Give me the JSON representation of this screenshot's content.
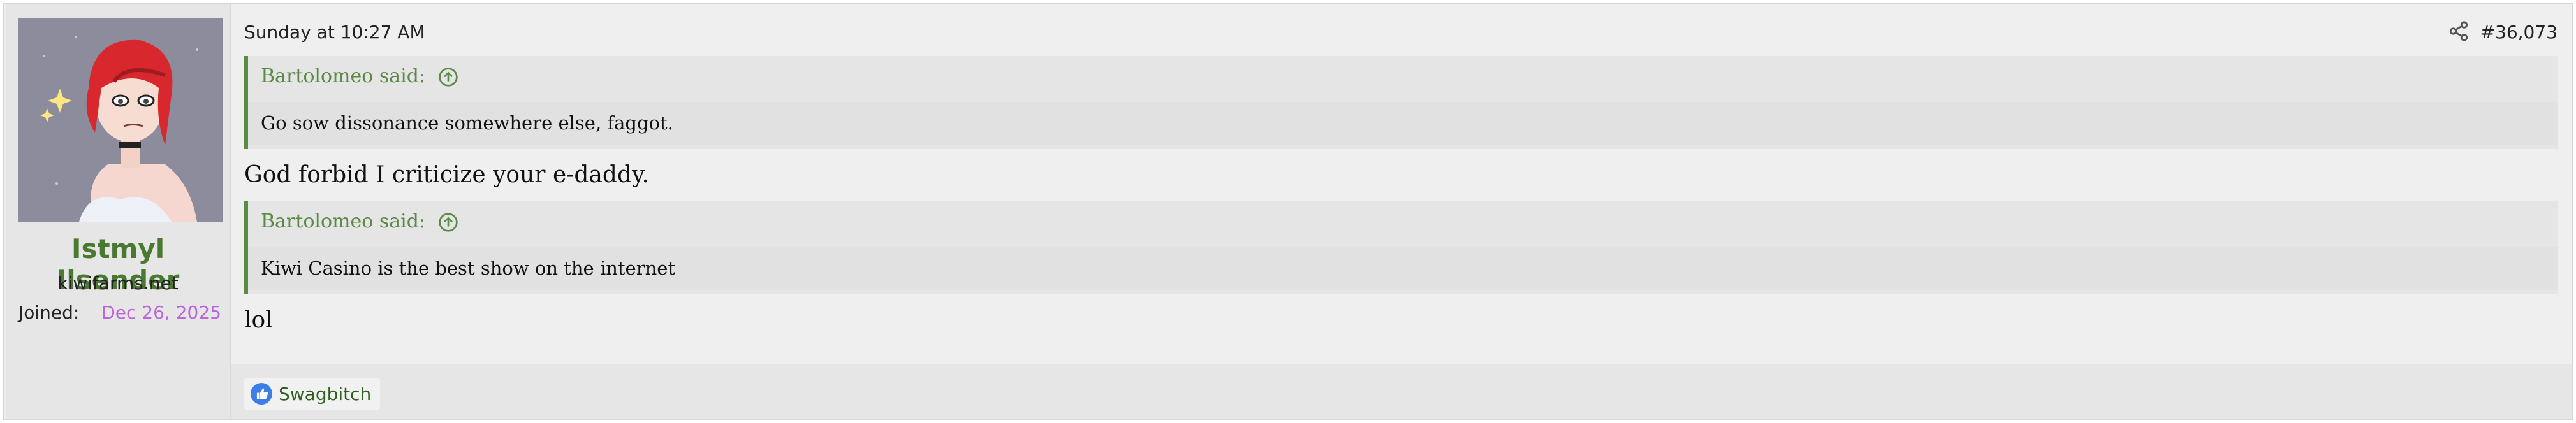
{
  "user": {
    "name": "Istmyl Ilsender",
    "title": "kiwifarms.net",
    "joined_label": "Joined:",
    "joined_date": "Dec 26, 2025"
  },
  "post": {
    "timestamp": "Sunday at 10:27 AM",
    "number": "#36,073",
    "share_icon": "share-icon"
  },
  "content": {
    "quote1": {
      "author": "Bartolomeo said:",
      "text": "Go sow dissonance somewhere else, faggot."
    },
    "reply1": "God forbid I criticize your e-daddy.",
    "quote2": {
      "author": "Bartolomeo said:",
      "text": "Kiwi Casino is the best show on the internet"
    },
    "reply2": "lol"
  },
  "reactions": {
    "icon": "thumbs-up-icon",
    "users": "Swagbitch"
  },
  "colors": {
    "username": "#4a7a32",
    "quote_accent": "#5b8a45",
    "joined_date": "#bb66dd"
  }
}
